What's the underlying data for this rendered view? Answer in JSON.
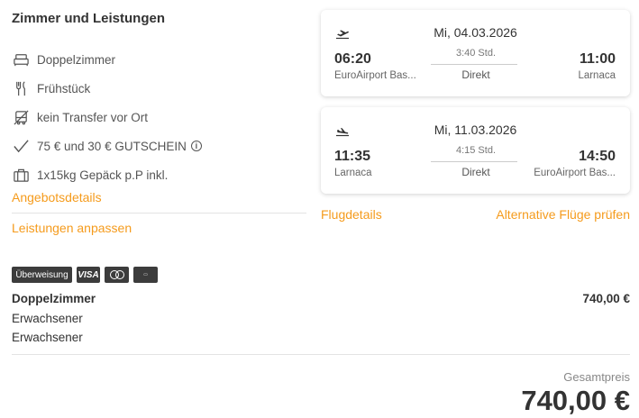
{
  "rooms": {
    "title": "Zimmer und Leistungen",
    "features": [
      {
        "icon": "bed-icon",
        "label": "Doppelzimmer"
      },
      {
        "icon": "cutlery-icon",
        "label": "Frühstück"
      },
      {
        "icon": "no-transfer-icon",
        "label": "kein Transfer vor Ort"
      },
      {
        "icon": "checkmark-icon",
        "label": "75 € und 30 € GUTSCHEIN"
      },
      {
        "icon": "luggage-icon",
        "label": "1x15kg Gepäck p.P inkl."
      }
    ],
    "offer_details_link": "Angebotsdetails",
    "customize_link": "Leistungen anpassen"
  },
  "flights": [
    {
      "direction_icon": "plane-departure-icon",
      "date": "Mi, 04.03.2026",
      "dep_time": "06:20",
      "dep_place": "EuroAirport Bas...",
      "duration": "3:40 Std.",
      "stops": "Direkt",
      "arr_time": "11:00",
      "arr_place": "Larnaca"
    },
    {
      "direction_icon": "plane-arrival-icon",
      "date": "Mi, 11.03.2026",
      "dep_time": "11:35",
      "dep_place": "Larnaca",
      "duration": "4:15 Std.",
      "stops": "Direkt",
      "arr_time": "14:50",
      "arr_place": "EuroAirport Bas..."
    }
  ],
  "flight_links": {
    "details": "Flugdetails",
    "alternatives": "Alternative Flüge prüfen"
  },
  "payment": {
    "methods": [
      "Überweisung",
      "VISA",
      "MasterCard",
      "American Express"
    ]
  },
  "summary": {
    "room_title": "Doppelzimmer",
    "room_price": "740,00 €",
    "passengers": [
      "Erwachsener",
      "Erwachsener"
    ],
    "total_label": "Gesamtpreis",
    "total_value": "740,00 €"
  },
  "colors": {
    "accent": "#f59b1c",
    "text": "#333333",
    "badge_bg": "#3c3c3c"
  }
}
